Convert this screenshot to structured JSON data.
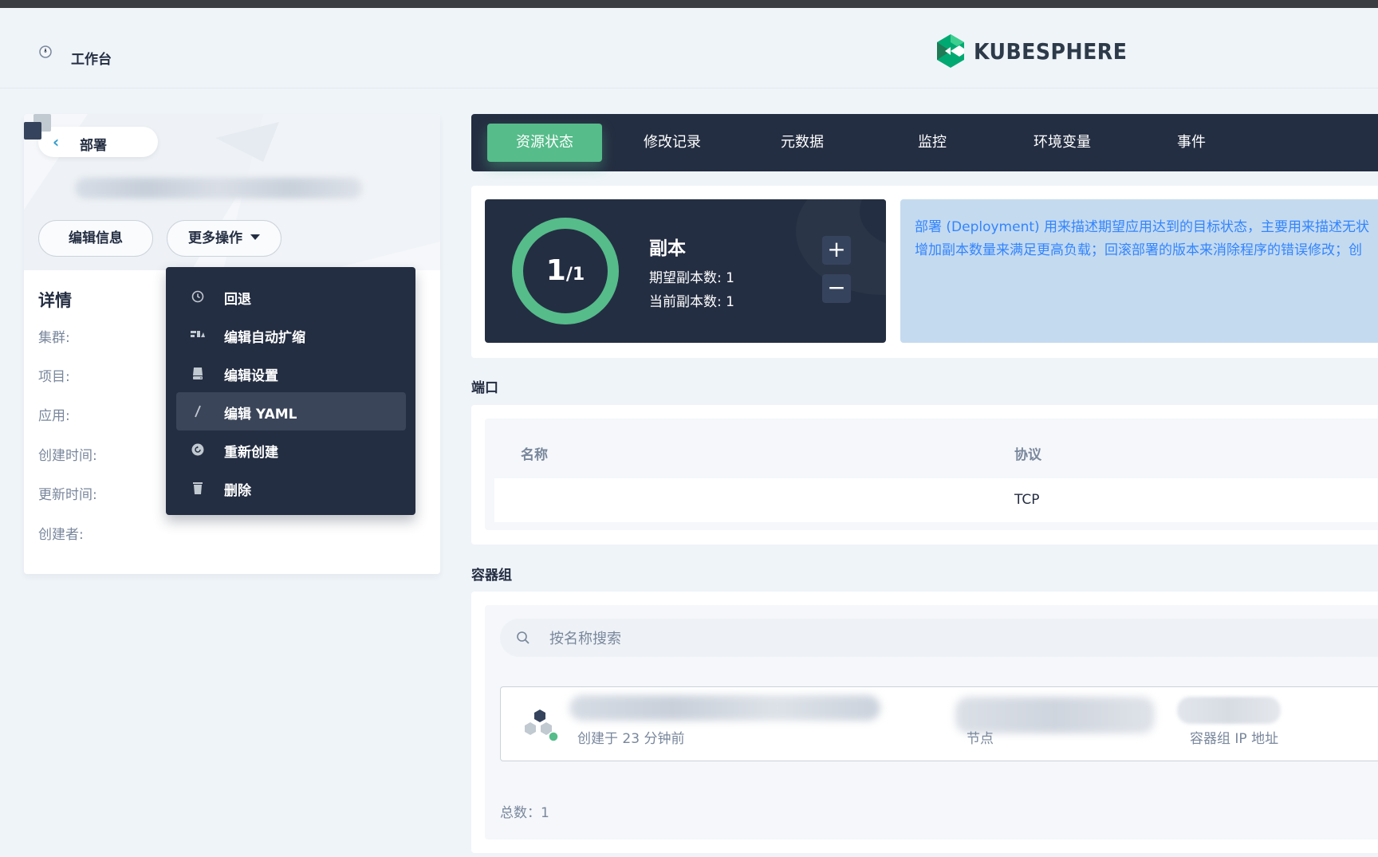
{
  "header": {
    "workbench_label": "工作台",
    "logo_text": "KUBESPHERE"
  },
  "left_panel": {
    "back_label": "部署",
    "edit_info_label": "编辑信息",
    "more_actions_label": "更多操作",
    "details_title": "详情",
    "details_labels": [
      "集群:",
      "项目:",
      "应用:",
      "创建时间:",
      "更新时间:",
      "创建者:"
    ]
  },
  "dropdown": {
    "items": [
      {
        "label": "回退",
        "icon": "history-icon"
      },
      {
        "label": "编辑自动扩缩",
        "icon": "autoscale-icon"
      },
      {
        "label": "编辑设置",
        "icon": "settings-icon"
      },
      {
        "label": "编辑 YAML",
        "icon": "pen-icon"
      },
      {
        "label": "重新创建",
        "icon": "refresh-icon"
      },
      {
        "label": "删除",
        "icon": "trash-icon"
      }
    ],
    "active_index": 3
  },
  "tabs": [
    "资源状态",
    "修改记录",
    "元数据",
    "监控",
    "环境变量",
    "事件"
  ],
  "active_tab": 0,
  "replica": {
    "current": "1",
    "desired_fraction": "/1",
    "title": "副本",
    "desired_line": "期望副本数: 1",
    "current_line": "当前副本数: 1",
    "ready_ratio": 1.0
  },
  "info_box": {
    "line1": "部署 (Deployment) 用来描述期望应用达到的目标状态，主要用来描述无状",
    "line2": "增加副本数量来满足更高负载；回滚部署的版本来消除程序的错误修改；创"
  },
  "ports": {
    "section_title": "端口",
    "header_name": "名称",
    "header_protocol": "协议",
    "row_protocol": "TCP"
  },
  "pods": {
    "section_title": "容器组",
    "search_placeholder": "按名称搜索",
    "created_text": "创建于 23 分钟前",
    "node_label": "节点",
    "ip_label": "容器组 IP 地址",
    "total_text": "总数：1"
  },
  "colors": {
    "accent_green": "#55bc8a",
    "dark_navy": "#242e42",
    "info_blue": "#3385ff",
    "background": "#eff4f9"
  }
}
